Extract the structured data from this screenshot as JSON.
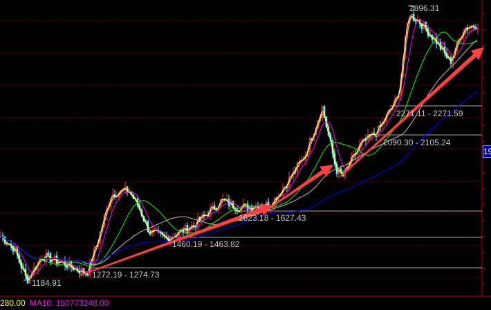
{
  "chart_data": {
    "type": "candlestick",
    "title": "",
    "annotations": {
      "high_label": "2896.31",
      "low_label": "1184.91",
      "ranges": [
        {
          "text": "1272.19 - 1274.73",
          "low": 1272.19,
          "high": 1274.73
        },
        {
          "text": "1460.19 - 1463.82",
          "low": 1460.19,
          "high": 1463.82
        },
        {
          "text": "1623.18 - 1627.43",
          "low": 1623.18,
          "high": 1627.43
        },
        {
          "text": "2090.30 - 2105.24",
          "low": 2090.3,
          "high": 2105.24
        },
        {
          "text": "2271.11 - 2271.59",
          "low": 2271.11,
          "high": 2271.59
        }
      ]
    },
    "ylim": [
      1140,
      2940
    ],
    "price_path": [
      [
        0,
        1466
      ],
      [
        20,
        1380
      ],
      [
        38,
        1185
      ],
      [
        60,
        1337
      ],
      [
        90,
        1293
      ],
      [
        125,
        1228
      ],
      [
        140,
        1423
      ],
      [
        160,
        1726
      ],
      [
        185,
        1748
      ],
      [
        200,
        1640
      ],
      [
        215,
        1488
      ],
      [
        240,
        1445
      ],
      [
        280,
        1531
      ],
      [
        320,
        1683
      ],
      [
        345,
        1640
      ],
      [
        390,
        1661
      ],
      [
        410,
        1770
      ],
      [
        440,
        1965
      ],
      [
        465,
        2268
      ],
      [
        485,
        1878
      ],
      [
        495,
        1835
      ],
      [
        520,
        2030
      ],
      [
        545,
        2116
      ],
      [
        575,
        2333
      ],
      [
        590,
        2853
      ],
      [
        605,
        2810
      ],
      [
        630,
        2680
      ],
      [
        650,
        2550
      ],
      [
        670,
        2766
      ],
      [
        690,
        2788
      ]
    ],
    "moving_averages": [
      {
        "period": 5,
        "color": "#ffffff"
      },
      {
        "period": 10,
        "color": "#ffff00"
      },
      {
        "period": 20,
        "color": "#ff00ff"
      },
      {
        "period": 60,
        "color": "#00ff00"
      },
      {
        "period": 120,
        "color": "#c0c0c0"
      },
      {
        "period": 250,
        "color": "#0000ff"
      }
    ],
    "trend_arrows": 3,
    "grid": true,
    "up_color": "#ff3232",
    "down_color": "#54ffff"
  },
  "legend": {
    "vol_value": "280.00",
    "ma10": "MA10: 150773248.00"
  },
  "axis": {
    "current_tag": "19"
  }
}
